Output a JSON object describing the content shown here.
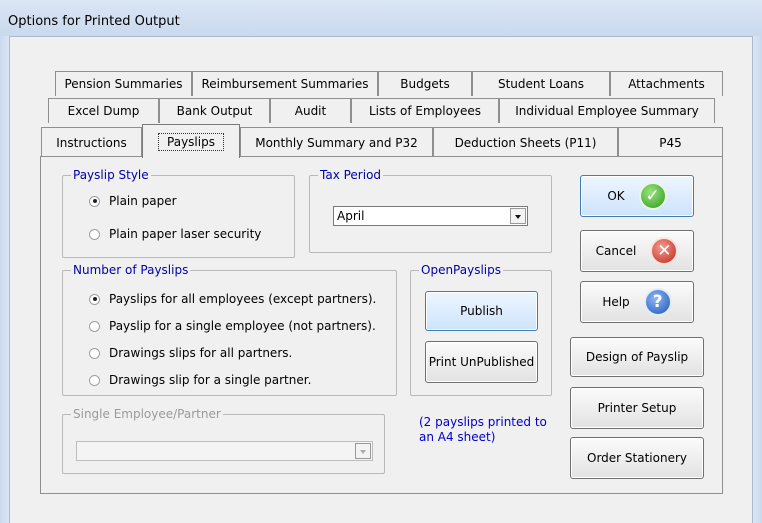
{
  "window": {
    "title": "Options for Printed Output"
  },
  "tabs": {
    "row1": [
      "Pension Summaries",
      "Reimbursement Summaries",
      "Budgets",
      "Student Loans",
      "Attachments"
    ],
    "row2": [
      "Excel Dump",
      "Bank Output",
      "Audit",
      "Lists of Employees",
      "Individual Employee Summary"
    ],
    "row3": [
      "Instructions",
      "Payslips",
      "Monthly Summary and P32",
      "Deduction Sheets (P11)",
      "P45"
    ],
    "active": "Payslips"
  },
  "payslip_style": {
    "legend": "Payslip Style",
    "options": [
      "Plain paper",
      "Plain paper laser security"
    ],
    "selected_index": 0
  },
  "tax_period": {
    "legend": "Tax Period",
    "value": "April"
  },
  "number_of_payslips": {
    "legend": "Number of Payslips",
    "options": [
      "Payslips for all employees (except partners).",
      "Payslip for a single employee (not partners).",
      "Drawings slips for all partners.",
      "Drawings slip for a single partner."
    ],
    "selected_index": 0
  },
  "open_payslips": {
    "legend": "OpenPayslips",
    "publish_label": "Publish",
    "print_unpublished_label": "Print UnPublished"
  },
  "single_employee": {
    "legend": "Single Employee/Partner",
    "value": ""
  },
  "note": {
    "line1": "(2 payslips printed to",
    "line2": "an A4 sheet)"
  },
  "buttons": {
    "ok": "OK",
    "cancel": "Cancel",
    "help": "Help",
    "design": "Design of Payslip",
    "printer_setup": "Printer Setup",
    "order_stationery": "Order Stationery"
  },
  "icons": {
    "ok": "check-icon",
    "cancel": "close-icon",
    "help": "help-icon"
  },
  "colors": {
    "legend": "#0000aa",
    "note": "#0000cc",
    "ok": "#2e9a1f",
    "cancel": "#c0281c",
    "help": "#1d55b8"
  }
}
